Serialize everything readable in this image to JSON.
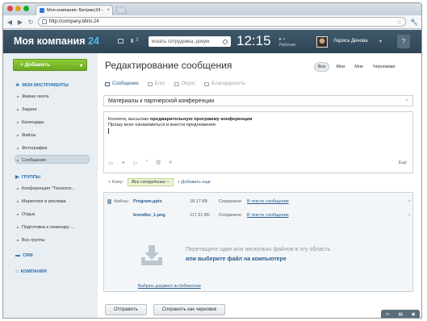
{
  "browser": {
    "tab_title": "Моя компания: Битрикс24 -",
    "tab_close": "×",
    "url": "http://company.bitrix.24"
  },
  "header": {
    "logo_text": "Моя компания",
    "logo_num": "24",
    "icon1_count": "3",
    "search_placeholder": "искать сотрудника, докум",
    "clock": "12:15",
    "work_status": "Работаю",
    "user_name": "Лариса Динова",
    "help": "?"
  },
  "sidebar": {
    "add_button": "+ Добавить",
    "sections": {
      "my_tools": "МОИ ИНСТРУМЕНТЫ",
      "groups": "ГРУППЫ",
      "crm": "CRM",
      "company": "КОМПАНИЯ"
    },
    "tools": [
      "Живая лента",
      "Задачи",
      "Календарь",
      "Файлы",
      "Фотографии",
      "Сообщения"
    ],
    "groups": [
      "Конференция \"Технолог...",
      "Маркетинг и реклама",
      "Отдых",
      "Подготовка к семинару ...",
      "Все группы"
    ]
  },
  "main": {
    "title": "Редактирование сообщения",
    "filters": [
      "Все",
      "Мои",
      "Мне",
      "Черновики"
    ],
    "tabs": [
      "Сообщение",
      "Блог",
      "Опрос",
      "Благодарность"
    ],
    "subject": "Материалы к партнерской конференции",
    "editor_line1_a": "Коллеги, высылаю ",
    "editor_line1_b": "предварительную программу конференции",
    "editor_line2": "Прошу всех ознакомиться и внести предложения.",
    "editor_more": "Ещё",
    "recipients_label": "+ Кому:",
    "recipient_chip": "Все сотрудники",
    "add_more": "+ Добавить еще",
    "files_label": "Файлы:",
    "files": [
      {
        "name": "Program.pptx",
        "size": "18.17 КБ",
        "status": "Сохранено",
        "place": "В тексте сообщения"
      },
      {
        "name": "brendbo_1.png",
        "size": "117.31 КБ",
        "status": "Сохранено",
        "place": "В тексте сообщения"
      }
    ],
    "drop_text": "Перетащите один или несколько файлов в эту область",
    "drop_link": "или выберите файл на компьютере",
    "from_library": "Выбрать документ из библиотеки",
    "send_button": "Отправить",
    "draft_button": "Сохранить как черновик"
  },
  "colors": {
    "header_bg": "#2e4454",
    "accent_blue": "#2a5d8f",
    "add_green": "#6aa81f",
    "logo_num": "#53b7ee"
  }
}
